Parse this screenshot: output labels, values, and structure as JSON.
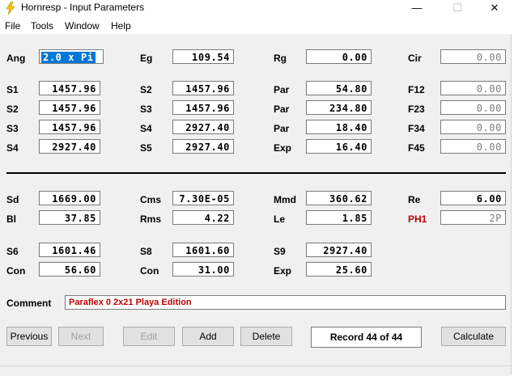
{
  "window": {
    "title": "Hornresp - Input Parameters"
  },
  "menu": [
    "File",
    "Tools",
    "Window",
    "Help"
  ],
  "params": {
    "Ang": {
      "label": "Ang",
      "value": "2.0 x Pi"
    },
    "Eg": {
      "label": "Eg",
      "value": "109.54"
    },
    "Rg": {
      "label": "Rg",
      "value": "0.00"
    },
    "Cir": {
      "label": "Cir",
      "value": "0.00"
    },
    "S1": {
      "label": "S1",
      "value": "1457.96"
    },
    "S2a": {
      "label": "S2",
      "value": "1457.96"
    },
    "Par1": {
      "label": "Par",
      "value": "54.80"
    },
    "F12": {
      "label": "F12",
      "value": "0.00"
    },
    "S2": {
      "label": "S2",
      "value": "1457.96"
    },
    "S3a": {
      "label": "S3",
      "value": "1457.96"
    },
    "Par2": {
      "label": "Par",
      "value": "234.80"
    },
    "F23": {
      "label": "F23",
      "value": "0.00"
    },
    "S3": {
      "label": "S3",
      "value": "1457.96"
    },
    "S4a": {
      "label": "S4",
      "value": "2927.40"
    },
    "Par3": {
      "label": "Par",
      "value": "18.40"
    },
    "F34": {
      "label": "F34",
      "value": "0.00"
    },
    "S4": {
      "label": "S4",
      "value": "2927.40"
    },
    "S5": {
      "label": "S5",
      "value": "2927.40"
    },
    "Exp1": {
      "label": "Exp",
      "value": "16.40"
    },
    "F45": {
      "label": "F45",
      "value": "0.00"
    },
    "Sd": {
      "label": "Sd",
      "value": "1669.00"
    },
    "Cms": {
      "label": "Cms",
      "value": "7.30E-05"
    },
    "Mmd": {
      "label": "Mmd",
      "value": "360.62"
    },
    "Re": {
      "label": "Re",
      "value": "6.00"
    },
    "Bl": {
      "label": "Bl",
      "value": "37.85"
    },
    "Rms": {
      "label": "Rms",
      "value": "4.22"
    },
    "Le": {
      "label": "Le",
      "value": "1.85"
    },
    "PH1": {
      "label": "PH1",
      "value": "2P"
    },
    "S6": {
      "label": "S6",
      "value": "1601.46"
    },
    "S8": {
      "label": "S8",
      "value": "1601.60"
    },
    "S9": {
      "label": "S9",
      "value": "2927.40"
    },
    "Con1": {
      "label": "Con",
      "value": "56.60"
    },
    "Con2": {
      "label": "Con",
      "value": "31.00"
    },
    "Exp2": {
      "label": "Exp",
      "value": "25.60"
    }
  },
  "comment": {
    "label": "Comment",
    "value": "Paraflex 0 2x21 Playa Edition"
  },
  "buttons": {
    "previous": "Previous",
    "next": "Next",
    "edit": "Edit",
    "add": "Add",
    "delete": "Delete",
    "record": "Record 44 of 44",
    "calculate": "Calculate"
  },
  "colors": {
    "selection": "#0078d7",
    "highlight_label": "#c00000",
    "comment_text": "#c00000"
  }
}
